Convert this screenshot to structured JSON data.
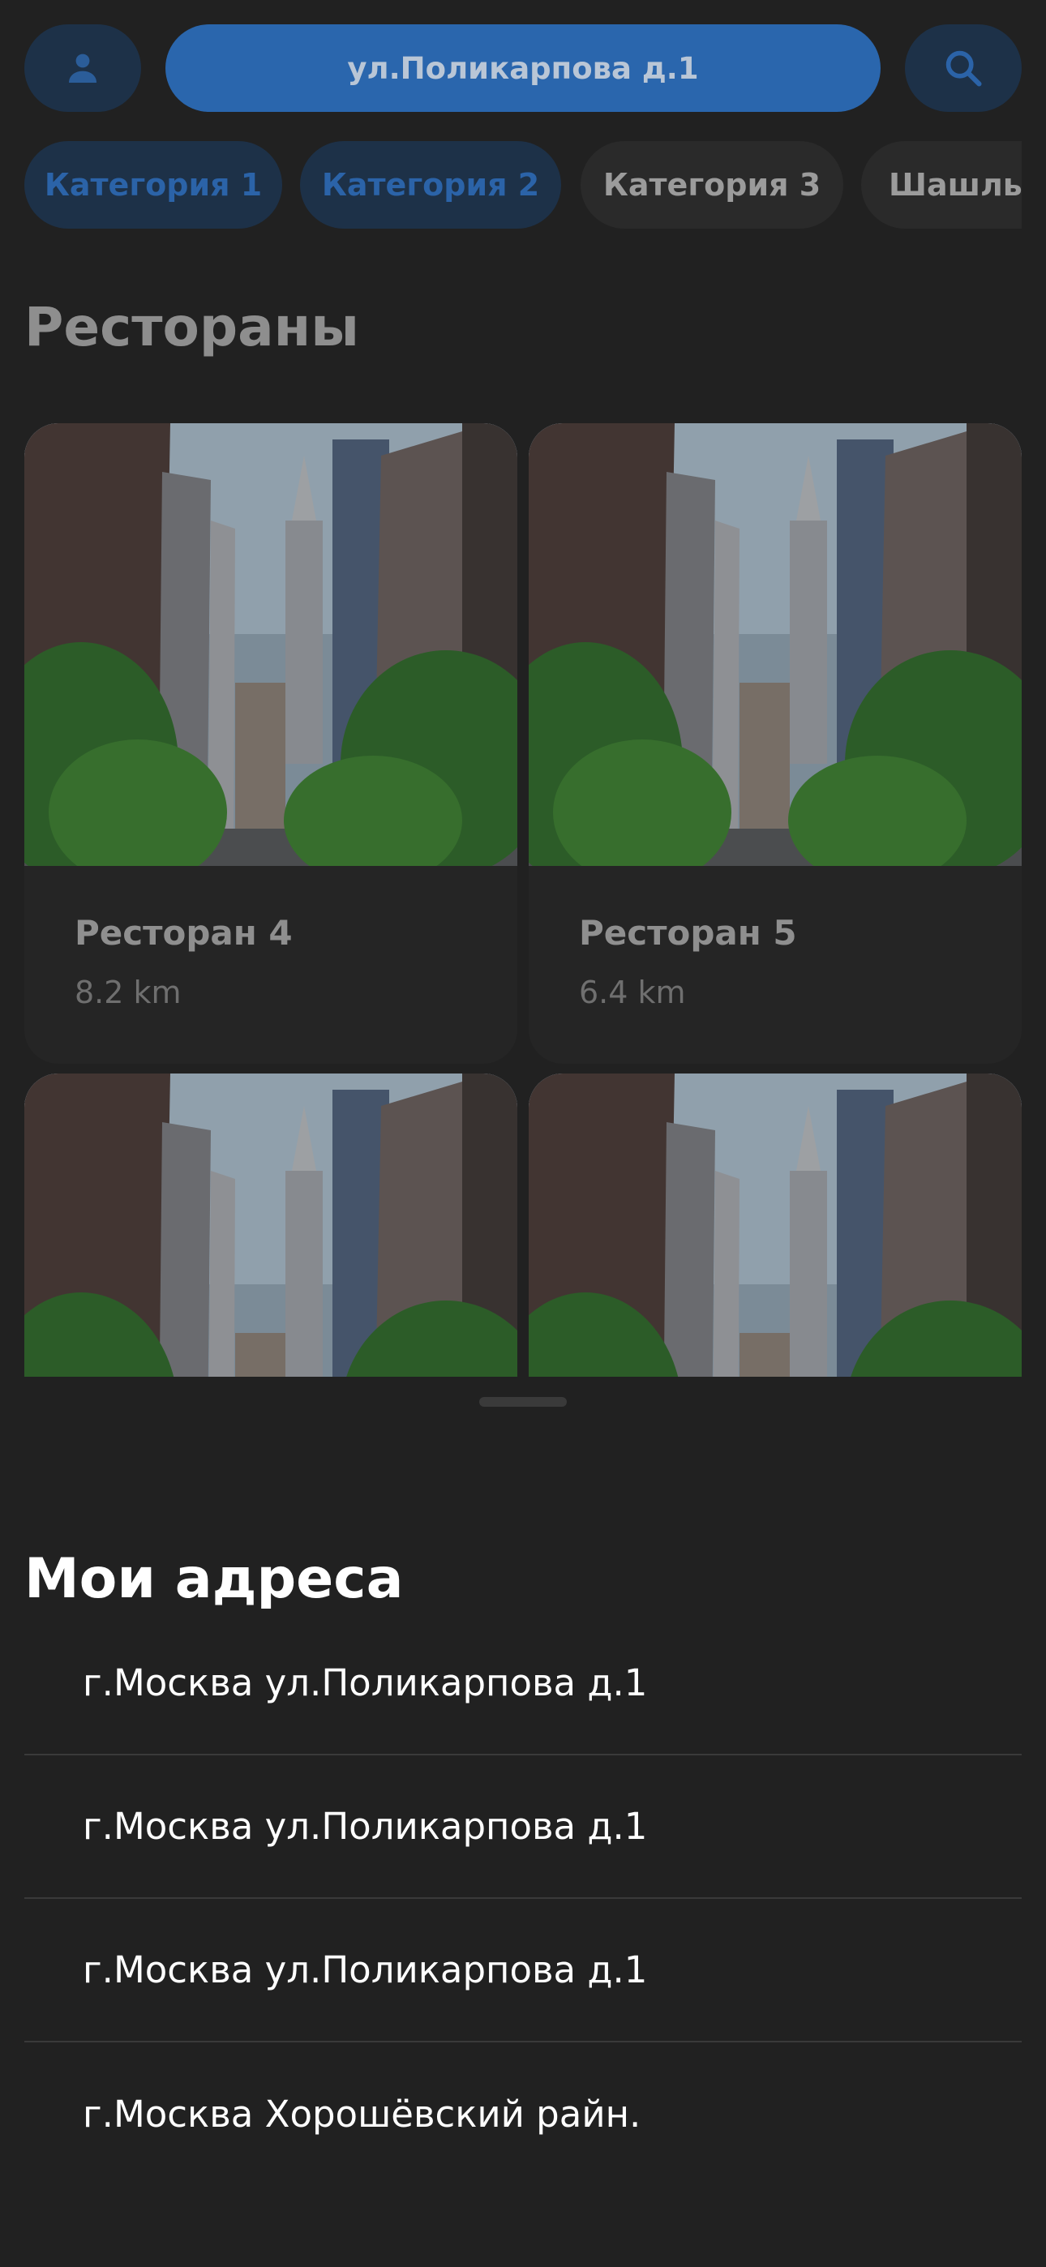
{
  "header": {
    "current_address": "ул.Поликарпова д.1",
    "profile_icon": "person-icon",
    "search_icon": "search-icon"
  },
  "categories": [
    "Категория 1",
    "Категория 2",
    "Категория 3",
    "Шашлык"
  ],
  "restaurants_title": "Рестораны",
  "restaurants": [
    {
      "name": "Ресторан 4",
      "distance": "8.2 km"
    },
    {
      "name": "Ресторан 5",
      "distance": "6.4 km"
    }
  ],
  "addresses_sheet": {
    "title": "Мои адреса",
    "items": [
      "г.Москва ул.Поликарпова д.1",
      "г.Москва ул.Поликарпова д.1",
      "г.Москва ул.Поликарпова д.1",
      "г.Москва Хорошёвский райн."
    ]
  },
  "colors": {
    "accent": "#2a66ad",
    "background": "#212121",
    "sheet_text": "#ffffff"
  }
}
